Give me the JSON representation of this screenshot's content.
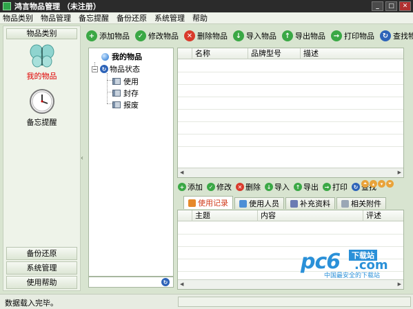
{
  "window": {
    "title": "鸿言物品管理 （未注册）"
  },
  "menu": [
    "物品类别",
    "物品管理",
    "备忘提醒",
    "备份还原",
    "系统管理",
    "帮助"
  ],
  "left_panel": {
    "header": "物品类别",
    "nav": [
      {
        "label": "我的物品",
        "icon": "butterfly-icon",
        "active": true
      },
      {
        "label": "备忘提醒",
        "icon": "clock-icon",
        "active": false
      }
    ],
    "bottom_buttons": [
      "备份还原",
      "系统管理",
      "使用帮助"
    ]
  },
  "toolbar": {
    "add": "添加物品",
    "edit": "修改物品",
    "delete": "删除物品",
    "import": "导入物品",
    "export": "导出物品",
    "print": "打印物品",
    "find": "查找物品"
  },
  "tree": {
    "root": "我的物品",
    "status_node": "物品状态",
    "children": [
      "使用",
      "封存",
      "报废"
    ]
  },
  "items_table": {
    "columns": [
      "名称",
      "品牌型号",
      "描述"
    ]
  },
  "sub_toolbar": {
    "add": "添加",
    "edit": "修改",
    "delete": "删除",
    "import": "导入",
    "export": "导出",
    "print": "打印",
    "find": "查找"
  },
  "tabs": [
    "使用记录",
    "使用人员",
    "补充资料",
    "相关附件"
  ],
  "records_table": {
    "columns": [
      "主题",
      "内容",
      "评述"
    ]
  },
  "status": {
    "text": "数据载入完毕。"
  },
  "watermark": {
    "brand": "pc6",
    "tag": "下载站",
    "domain": ".com",
    "slogan": "中国最安全的下载站"
  }
}
